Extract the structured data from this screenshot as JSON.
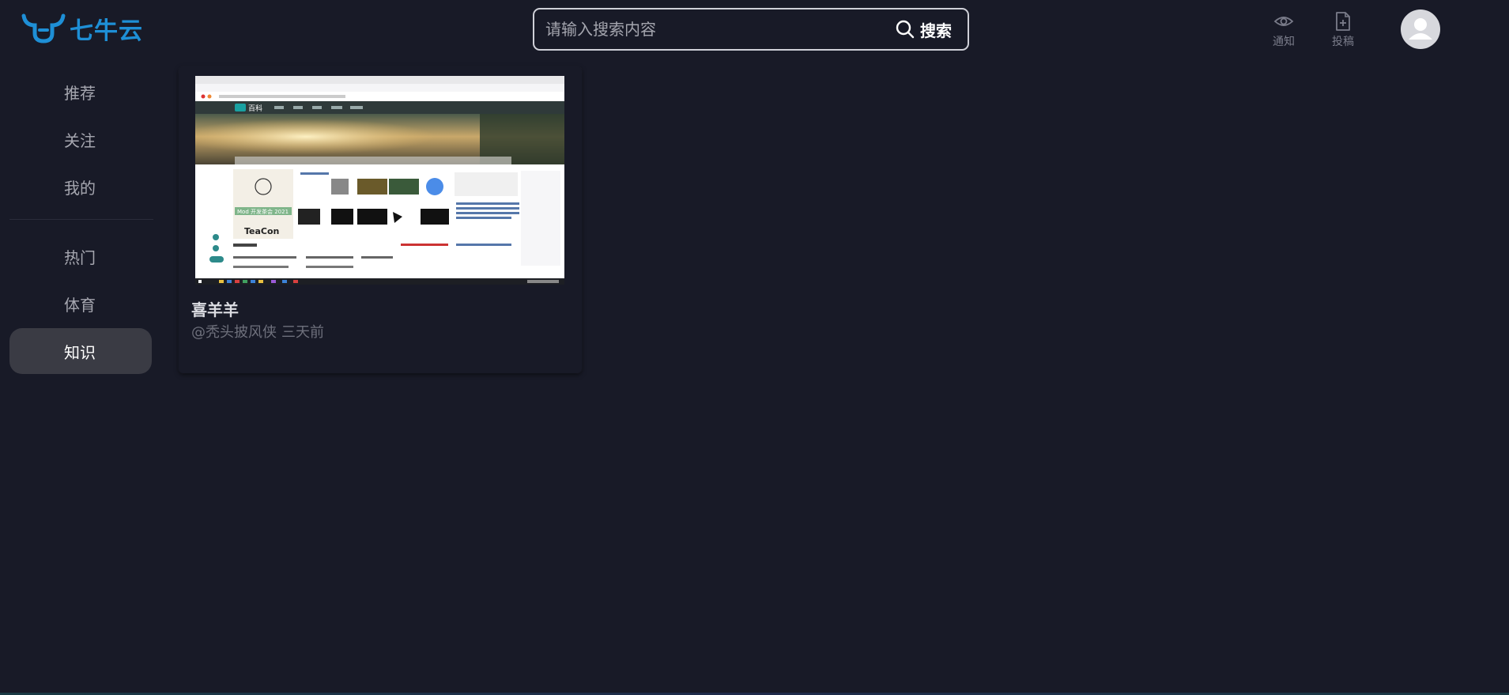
{
  "header": {
    "logo_text": "七牛云",
    "search": {
      "placeholder": "请输入搜索内容",
      "button_label": "搜索"
    },
    "actions": [
      {
        "label": "通知",
        "icon": "eye-icon"
      },
      {
        "label": "投稿",
        "icon": "document-plus-icon"
      }
    ],
    "avatar_icon": "user-icon"
  },
  "sidebar": {
    "items": [
      {
        "label": "推荐",
        "active": false
      },
      {
        "label": "关注",
        "active": false
      },
      {
        "label": "我的",
        "active": false
      },
      {
        "label": "热门",
        "active": false
      },
      {
        "label": "体育",
        "active": false
      },
      {
        "label": "知识",
        "active": true
      }
    ]
  },
  "feed": {
    "cards": [
      {
        "title": "喜羊羊",
        "author": "@秃头披风侠",
        "time": "三天前",
        "thumbnail": {
          "site_name": "百科",
          "promo_title": "TeaCon",
          "promo_banner": "Mod 开发茶会 2021"
        }
      }
    ]
  },
  "colors": {
    "background": "#181a27",
    "brand": "#1e8fd6",
    "active_nav": "#3a3b44"
  }
}
